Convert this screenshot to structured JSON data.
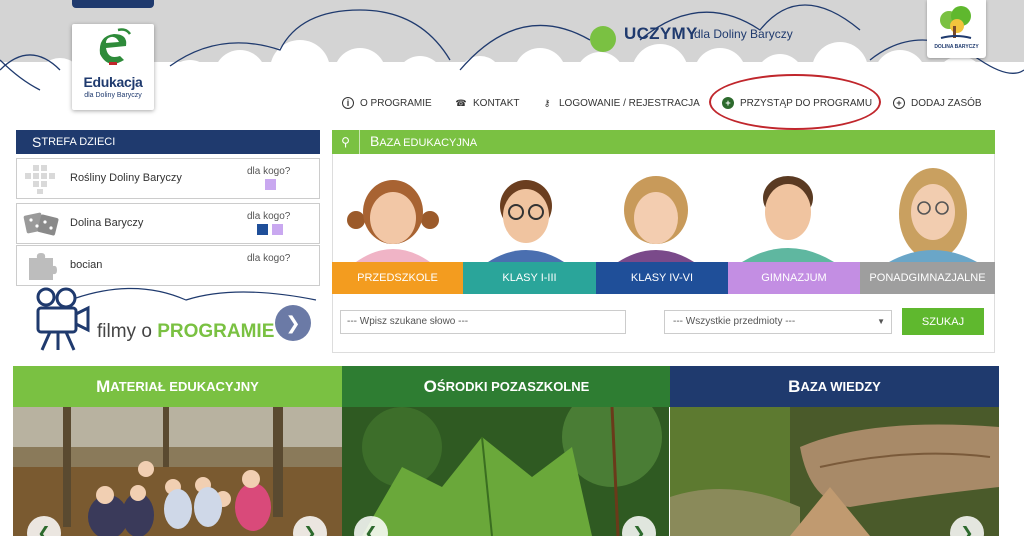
{
  "header": {
    "logo_name": "Edukacja",
    "logo_sub": "dla Doliny Baryczy",
    "tagline_bold": "UCZYMY",
    "tagline_rest": "dla Doliny Baryczy",
    "partner_label": "DOLINA BARYCZY"
  },
  "nav": {
    "items": [
      {
        "label": "O PROGRAMIE",
        "icon": "info-icon"
      },
      {
        "label": "KONTAKT",
        "icon": "phone-icon"
      },
      {
        "label": "LOGOWANIE / REJESTRACJA",
        "icon": "key-icon"
      },
      {
        "label": "PRZYSTĄP DO PROGRAMU",
        "icon": "plus-circle-icon"
      },
      {
        "label": "DODAJ ZASÓB",
        "icon": "plus-circle-icon"
      }
    ],
    "highlight_color": "#c0262c"
  },
  "strefa": {
    "title_big": "S",
    "title_small": "TREFA DZIECI",
    "dla_label": "dla kogo?",
    "items": [
      {
        "name": "Rośliny Doliny Baryczy"
      },
      {
        "name": "Dolina Baryczy"
      },
      {
        "name": "bocian"
      }
    ]
  },
  "filmy": {
    "prefix": "filmy o ",
    "bold": "PROGRAMIE"
  },
  "baza": {
    "title_big": "B",
    "title_small": "AZA EDUKACYJNA",
    "tabs": [
      {
        "label": "PRZEDSZKOLE",
        "color": "#f39c1f"
      },
      {
        "label": "KLASY I-III",
        "color": "#2aa59a"
      },
      {
        "label": "KLASY IV-VI",
        "color": "#1f4f99"
      },
      {
        "label": "GIMNAZJUM",
        "color": "#c38ee3"
      },
      {
        "label": "PONADGIMNAZJALNE",
        "color": "#9e9e9e"
      }
    ],
    "search_placeholder": "--- Wpisz szukane słowo ---",
    "select_value": "--- Wszystkie przedmioty ---",
    "search_button": "SZUKAJ"
  },
  "panels": [
    {
      "big": "M",
      "small": "ATERIAŁ EDUKACYJNY",
      "color": "#7ac142"
    },
    {
      "big": "O",
      "small": "ŚRODKI POZASZKOLNE",
      "color": "#2e7d32"
    },
    {
      "big": "B",
      "small": "AZA WIEDZY",
      "color": "#1f3a6e"
    }
  ],
  "colors": {
    "navy": "#1f3a6e",
    "green": "#7ac142"
  }
}
